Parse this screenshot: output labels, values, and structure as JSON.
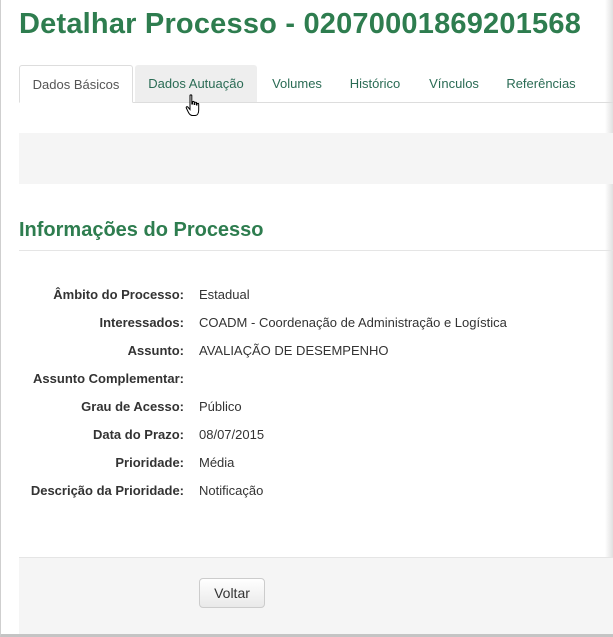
{
  "page": {
    "title": "Detalhar Processo - 02070001869201568"
  },
  "tabs": [
    {
      "label": "Dados Básicos",
      "state": "active"
    },
    {
      "label": "Dados Autuação",
      "state": "hover"
    },
    {
      "label": "Volumes",
      "state": "normal"
    },
    {
      "label": "Histórico",
      "state": "normal"
    },
    {
      "label": "Vínculos",
      "state": "normal"
    },
    {
      "label": "Referências",
      "state": "normal"
    }
  ],
  "section": {
    "title": "Informações do Processo"
  },
  "fields": [
    {
      "label": "Âmbito do Processo:",
      "value": "Estadual"
    },
    {
      "label": "Interessados:",
      "value": "COADM - Coordenação de Administração e Logística"
    },
    {
      "label": "Assunto:",
      "value": "AVALIAÇÃO DE DESEMPENHO"
    },
    {
      "label": "Assunto Complementar:",
      "value": ""
    },
    {
      "label": "Grau de Acesso:",
      "value": "Público"
    },
    {
      "label": "Data do Prazo:",
      "value": "08/07/2015"
    },
    {
      "label": "Prioridade:",
      "value": "Média"
    },
    {
      "label": "Descrição da Prioridade:",
      "value": "Notificação"
    }
  ],
  "footer": {
    "back_label": "Voltar"
  },
  "colors": {
    "accent": "#2e7d4f",
    "tab_text": "#2a6b54",
    "panel_bg": "#f5f5f5"
  },
  "icons": {
    "cursor": "hand-pointer-icon"
  }
}
